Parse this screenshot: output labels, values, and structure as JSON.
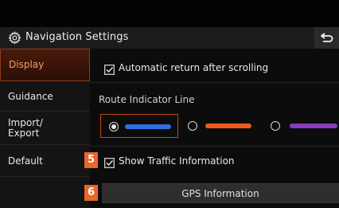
{
  "header": {
    "title": "Navigation Settings"
  },
  "sidebar": {
    "items": [
      {
        "label": "Display"
      },
      {
        "label": "Guidance"
      },
      {
        "label": "Import/",
        "label2": "Export"
      },
      {
        "label": "Default"
      }
    ],
    "selected": "Display"
  },
  "display": {
    "auto_return": {
      "label": "Automatic return after scrolling",
      "checked": true
    },
    "route_indicator": {
      "label": "Route Indicator Line",
      "options": [
        {
          "color": "#2f6fe0",
          "selected": true
        },
        {
          "color": "#f05a1e",
          "selected": false
        },
        {
          "color": "#8a3ac0",
          "selected": false
        }
      ]
    },
    "traffic": {
      "label": "Show Traffic Information",
      "checked": true
    },
    "gps_button": {
      "label": "GPS Information"
    }
  },
  "badges": {
    "traffic": "5",
    "gps": "6"
  },
  "colors": {
    "accent": "#e8672a",
    "selected_border": "#c04a18"
  }
}
